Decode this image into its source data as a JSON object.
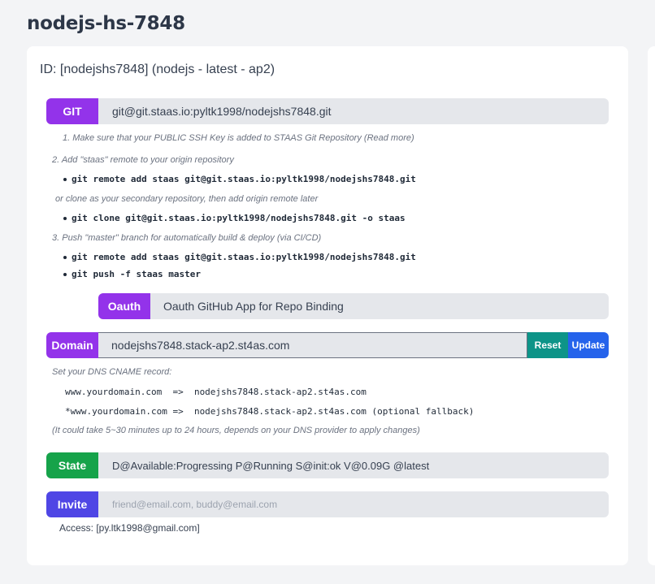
{
  "page_title": "nodejs-hs-7848",
  "card": {
    "id_line": "ID: [nodejshs7848] (nodejs - latest - ap2)"
  },
  "git": {
    "label": "GIT",
    "url": "git@git.staas.io:pyltk1998/nodejshs7848.git",
    "step1": "1. Make sure that your PUBLIC SSH Key is added to STAAS Git Repository (Read more)",
    "step2": "2. Add \"staas\" remote to your origin repository",
    "cmd_remote_add": "git remote add staas git@git.staas.io:pyltk1998/nodejshs7848.git",
    "or_clone": "or clone as your secondary repository, then add origin remote later",
    "cmd_clone": "git clone git@git.staas.io:pyltk1998/nodejshs7848.git -o staas",
    "step3": "3. Push \"master\" branch for automatically build & deploy (via CI/CD)",
    "cmd_remote_add_2": "git remote add staas git@git.staas.io:pyltk1998/nodejshs7848.git",
    "cmd_push": "git push -f staas master"
  },
  "oauth": {
    "label": "Oauth",
    "text": "Oauth GitHub App for Repo Binding"
  },
  "domain": {
    "label": "Domain",
    "value": "nodejshs7848.stack-ap2.st4as.com",
    "reset_label": "Reset",
    "update_label": "Update",
    "cname_note": "Set your DNS CNAME record:",
    "record1": "www.yourdomain.com  =>  nodejshs7848.stack-ap2.st4as.com",
    "record2": "*www.yourdomain.com =>  nodejshs7848.stack-ap2.st4as.com (optional fallback)",
    "timing_note": "(It could take 5~30 minutes up to 24 hours, depends on your DNS provider to apply changes)"
  },
  "state": {
    "label": "State",
    "text": "D@Available:Progressing P@Running S@init:ok V@0.09G  @latest"
  },
  "invite": {
    "label": "Invite",
    "placeholder": "friend@email.com, buddy@email.com",
    "access": "Access: [py.ltk1998@gmail.com]"
  },
  "colors": {
    "purple": "#9333ea",
    "teal": "#0d9488",
    "blue": "#2563eb",
    "green": "#16a34a",
    "indigo": "#4f46e5"
  }
}
